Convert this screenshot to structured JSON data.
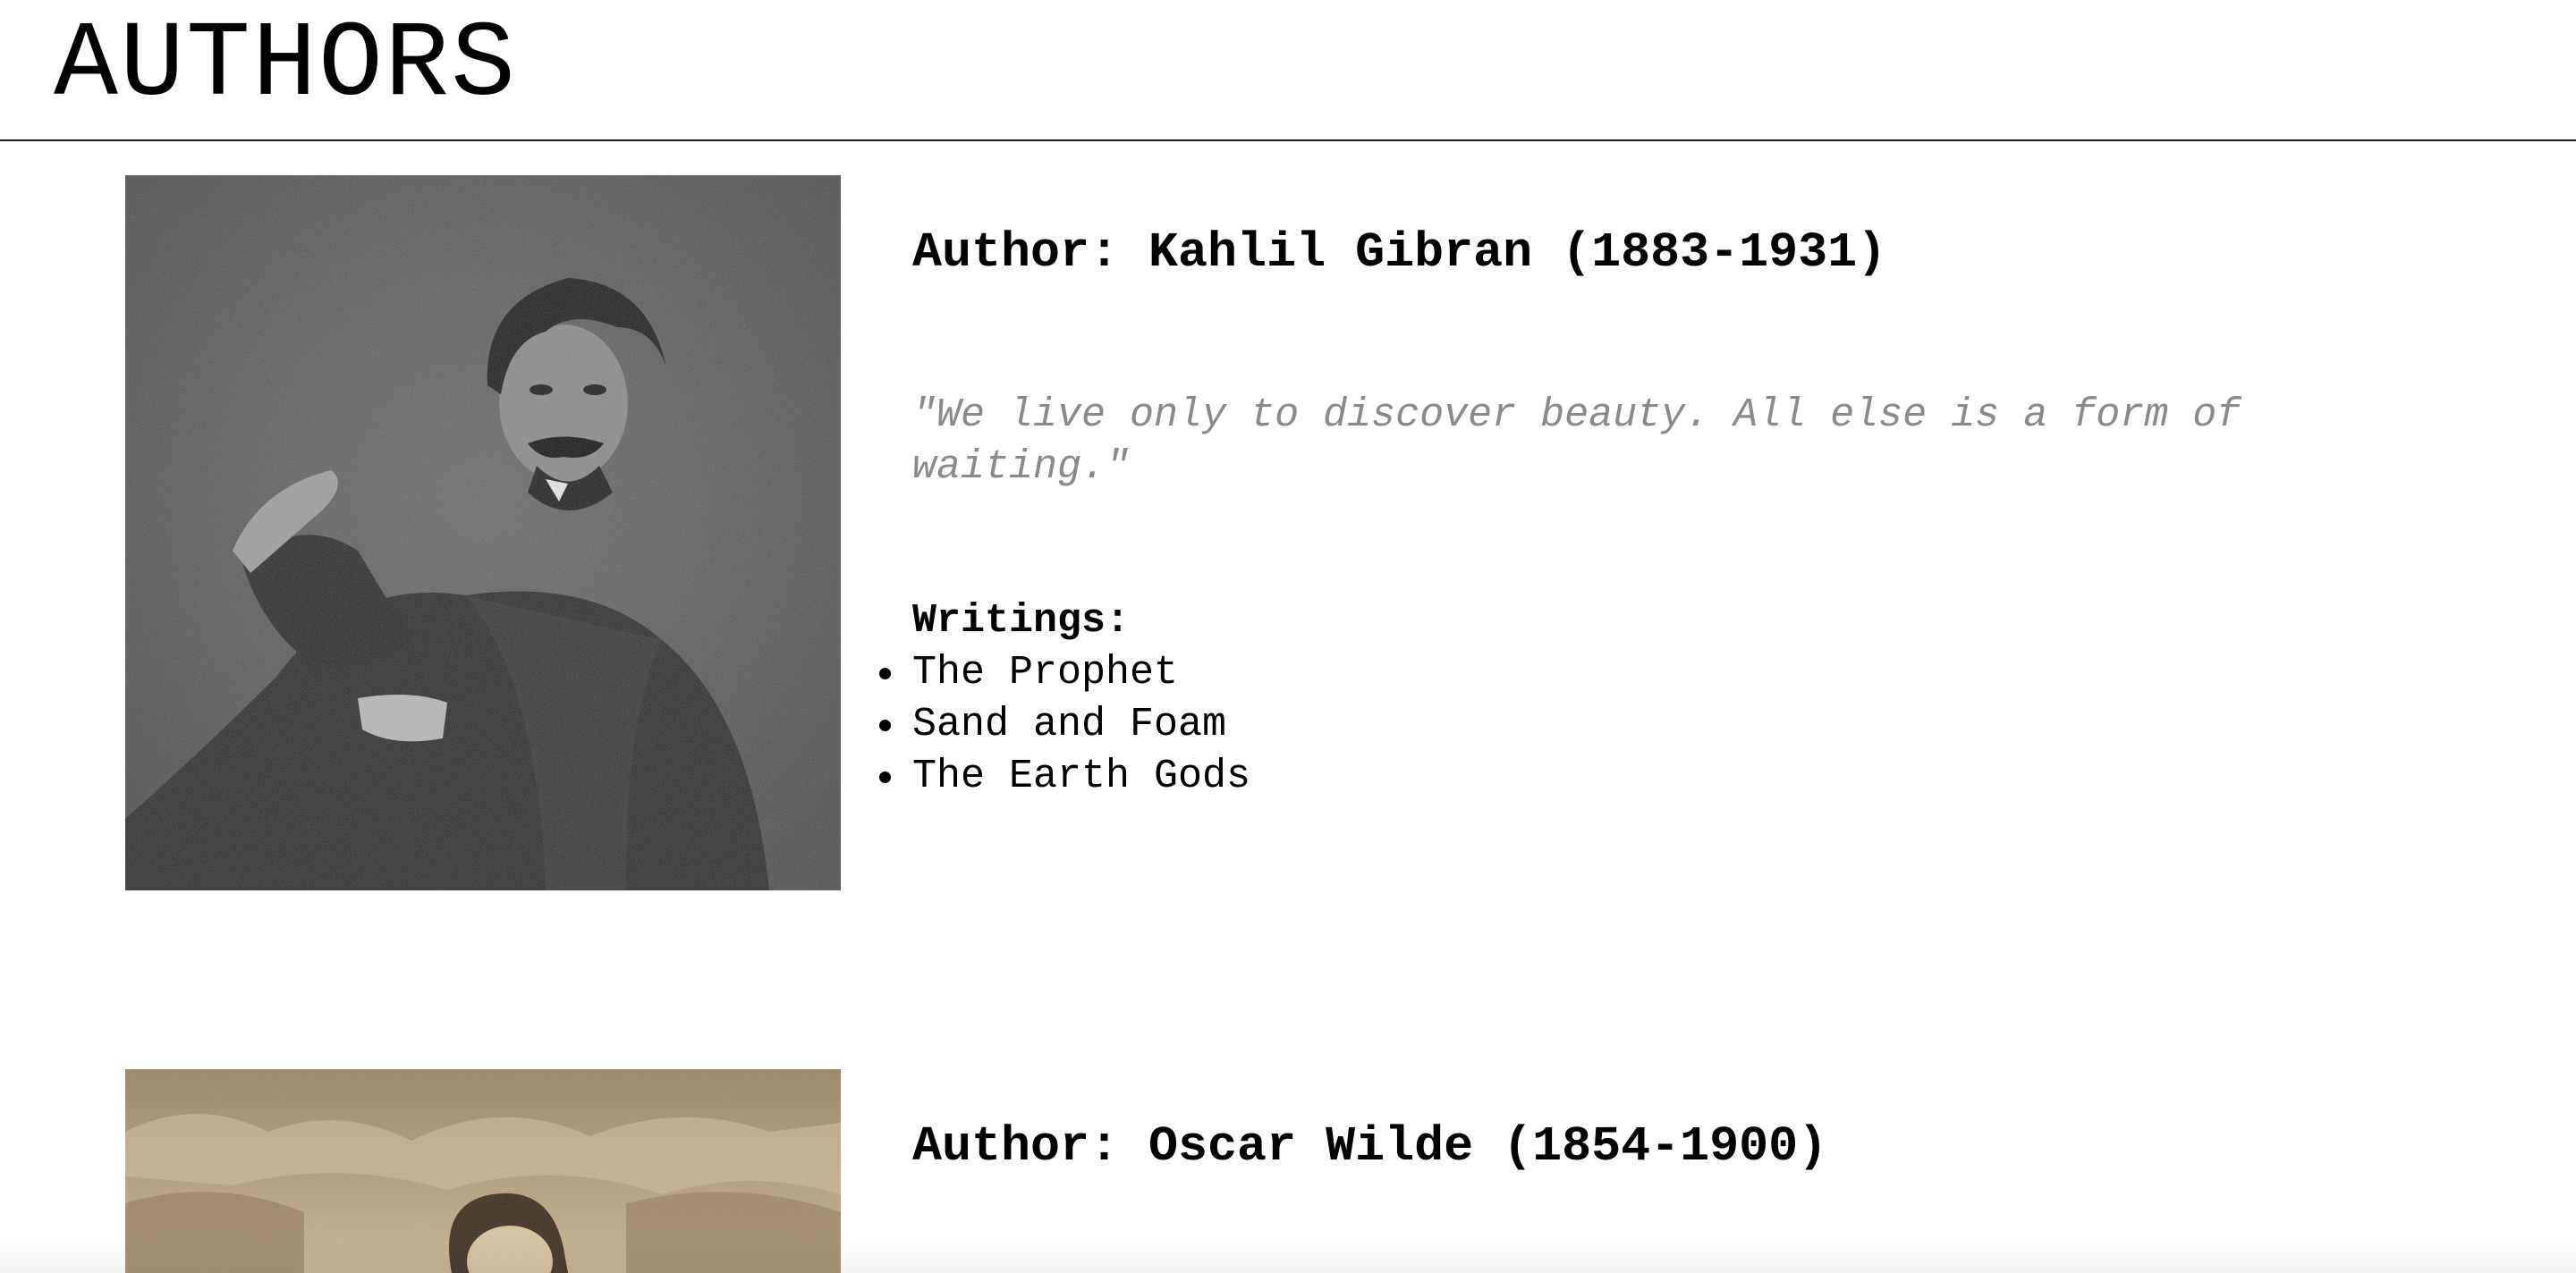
{
  "page": {
    "title": "AUTHORS"
  },
  "authors": [
    {
      "heading": "Author: Kahlil Gibran (1883-1931)",
      "quote": "\"We live only to discover beauty. All else is a form of waiting.\"",
      "writings_label": "Writings:",
      "writings": [
        "The Prophet",
        "Sand and Foam",
        "The Earth Gods"
      ],
      "portrait_tone": "grayscale"
    },
    {
      "heading": "Author: Oscar Wilde (1854-1900)",
      "portrait_tone": "sepia"
    }
  ]
}
